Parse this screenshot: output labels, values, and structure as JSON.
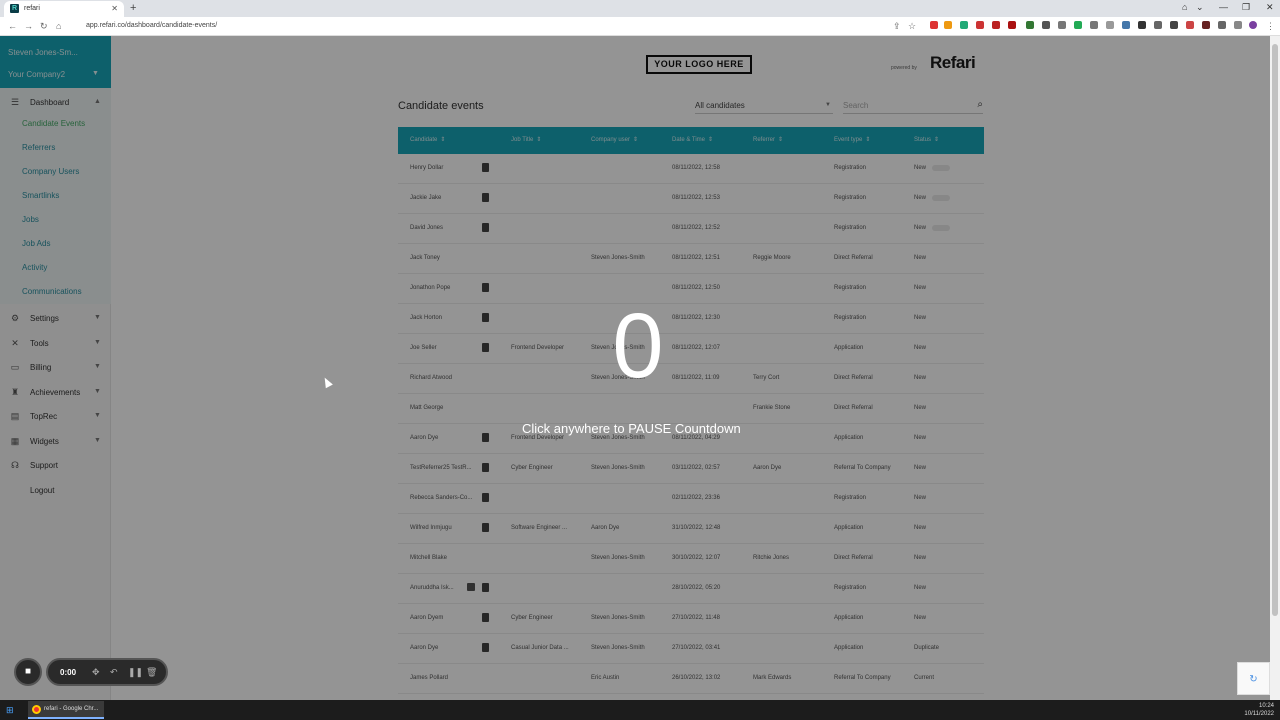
{
  "browser": {
    "tab_title": "refari",
    "url": "app.refari.co/dashboard/candidate-events/"
  },
  "sidebar": {
    "user_name": "Steven Jones-Sm...",
    "company": "Your Company2",
    "dashboard_label": "Dashboard",
    "dashboard_items": [
      "Candidate Events",
      "Referrers",
      "Company Users",
      "Smartlinks",
      "Jobs",
      "Job Ads",
      "Activity",
      "Communications"
    ],
    "items": [
      {
        "label": "Settings",
        "icon": "gear-icon",
        "glyph": "⚙",
        "chevron": true
      },
      {
        "label": "Tools",
        "icon": "tools-icon",
        "glyph": "✕",
        "chevron": true
      },
      {
        "label": "Billing",
        "icon": "card-icon",
        "glyph": "▭",
        "chevron": true
      },
      {
        "label": "Achievements",
        "icon": "trophy-icon",
        "glyph": "♜",
        "chevron": true
      },
      {
        "label": "TopRec",
        "icon": "chart-icon",
        "glyph": "▤",
        "chevron": true
      },
      {
        "label": "Widgets",
        "icon": "grid-icon",
        "glyph": "▦",
        "chevron": true
      },
      {
        "label": "Support",
        "icon": "headset-icon",
        "glyph": "☊",
        "chevron": false
      },
      {
        "label": "Logout",
        "icon": "",
        "glyph": "",
        "chevron": false
      }
    ]
  },
  "header": {
    "logo_placeholder": "YOUR LOGO HERE",
    "powered_by": "powered by",
    "brand": "Refari"
  },
  "main": {
    "title": "Candidate events",
    "filter_value": "All candidates",
    "search_placeholder": "Search",
    "columns": [
      "Candidate",
      "Job Title",
      "Company user",
      "Date & Time",
      "Referrer",
      "Event type",
      "Status"
    ],
    "rows": [
      {
        "candidate": "Henry Dollar",
        "doc": true,
        "job": "",
        "user": "",
        "date": "08/11/2022, 12:58",
        "referrer": "",
        "event": "Registration",
        "status": "New"
      },
      {
        "candidate": "Jackie Jake",
        "doc": true,
        "job": "",
        "user": "",
        "date": "08/11/2022, 12:53",
        "referrer": "",
        "event": "Registration",
        "status": "New"
      },
      {
        "candidate": "David Jones",
        "doc": true,
        "job": "",
        "user": "",
        "date": "08/11/2022, 12:52",
        "referrer": "",
        "event": "Registration",
        "status": "New"
      },
      {
        "candidate": "Jack Toney",
        "doc": false,
        "job": "",
        "user": "Steven Jones-Smith",
        "date": "08/11/2022, 12:51",
        "referrer": "Reggie Moore",
        "event": "Direct Referral",
        "status": "New"
      },
      {
        "candidate": "Jonathon Pope",
        "doc": true,
        "job": "",
        "user": "",
        "date": "08/11/2022, 12:50",
        "referrer": "",
        "event": "Registration",
        "status": "New"
      },
      {
        "candidate": "Jack Horton",
        "doc": true,
        "job": "",
        "user": "",
        "date": "08/11/2022, 12:30",
        "referrer": "",
        "event": "Registration",
        "status": "New"
      },
      {
        "candidate": "Joe Seller",
        "doc": true,
        "job": "Frontend Developer",
        "user": "Steven Jones-Smith",
        "date": "08/11/2022, 12:07",
        "referrer": "",
        "event": "Application",
        "status": "New"
      },
      {
        "candidate": "Richard Atwood",
        "doc": false,
        "job": "",
        "user": "Steven Jones-Smith",
        "date": "08/11/2022, 11:09",
        "referrer": "Terry Cort",
        "event": "Direct Referral",
        "status": "New"
      },
      {
        "candidate": "Matt George",
        "doc": false,
        "job": "",
        "user": "",
        "date": "",
        "referrer": "Frankie Stone",
        "event": "Direct Referral",
        "status": "New"
      },
      {
        "candidate": "Aaron Dye",
        "doc": true,
        "job": "Frontend Developer",
        "user": "Steven Jones-Smith",
        "date": "08/11/2022, 04:29",
        "referrer": "",
        "event": "Application",
        "status": "New"
      },
      {
        "candidate": "TestReferrer25 TestR...",
        "doc": true,
        "job": "Cyber Engineer",
        "user": "Steven Jones-Smith",
        "date": "03/11/2022, 02:57",
        "referrer": "Aaron Dye",
        "event": "Referral To Company",
        "status": "New"
      },
      {
        "candidate": "Rebecca Sanders-Co...",
        "doc": true,
        "job": "",
        "user": "",
        "date": "02/11/2022, 23:36",
        "referrer": "",
        "event": "Registration",
        "status": "New"
      },
      {
        "candidate": "Wilfred Inmjugu",
        "doc": true,
        "job": "Software Engineer ...",
        "user": "Aaron Dye",
        "date": "31/10/2022, 12:48",
        "referrer": "",
        "event": "Application",
        "status": "New"
      },
      {
        "candidate": "Mitchell Blake",
        "doc": false,
        "job": "",
        "user": "Steven Jones-Smith",
        "date": "30/10/2022, 12:07",
        "referrer": "Ritchie Jones",
        "event": "Direct Referral",
        "status": "New"
      },
      {
        "candidate": "Anuruddha Isk...",
        "doc": true,
        "linkedin": true,
        "job": "",
        "user": "",
        "date": "28/10/2022, 05:20",
        "referrer": "",
        "event": "Registration",
        "status": "New"
      },
      {
        "candidate": "Aaron Dyem",
        "doc": true,
        "job": "Cyber Engineer",
        "user": "Steven Jones-Smith",
        "date": "27/10/2022, 11:48",
        "referrer": "",
        "event": "Application",
        "status": "New"
      },
      {
        "candidate": "Aaron Dye",
        "doc": true,
        "job": "Casual Junior Data ...",
        "user": "Steven Jones-Smith",
        "date": "27/10/2022, 03:41",
        "referrer": "",
        "event": "Application",
        "status": "Duplicate"
      },
      {
        "candidate": "James Pollard",
        "doc": false,
        "job": "",
        "user": "Eric Austin",
        "date": "26/10/2022, 13:02",
        "referrer": "Mark Edwards",
        "event": "Referral To Company",
        "status": "Current"
      },
      {
        "candidate": "Mitchell Blake",
        "doc": true,
        "job": "Cyber Engineer",
        "user": "Steven Jones-Smith",
        "date": "26/10/2022, 12:50",
        "referrer": "-",
        "event": "Application",
        "status": "Current"
      }
    ]
  },
  "overlay": {
    "countdown": "0",
    "hint": "Click anywhere to PAUSE Countdown"
  },
  "recorder": {
    "time": "0:00"
  },
  "taskbar": {
    "app_label": "refari - Google Chr...",
    "time": "10:24",
    "date": "10/11/2022"
  }
}
